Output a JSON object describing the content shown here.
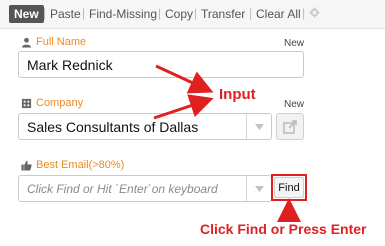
{
  "toolbar": {
    "new_label": "New",
    "paste_label": "Paste",
    "find_missing_label": "Find-Missing",
    "copy_label": "Copy",
    "transfer_label": "Transfer",
    "clear_all_label": "Clear All",
    "separator": "|"
  },
  "fields": {
    "full_name": {
      "label": "Full Name",
      "new_tag": "New",
      "value": "Mark Rednick",
      "icon": "person-icon"
    },
    "company": {
      "label": "Company",
      "new_tag": "New",
      "value": "Sales Consultants of Dallas",
      "icon": "building-icon"
    },
    "best_email": {
      "label": "Best Email(>80%)",
      "placeholder": "Click Find or Hit `Enter`on keyboard",
      "icon": "thumbs-up-icon",
      "find_label": "Find"
    }
  },
  "annotations": {
    "input_callout": "Input",
    "find_callout": "Click Find or Press Enter"
  },
  "colors": {
    "accent_label": "#ee8a20",
    "annotation": "#e02020",
    "toolbar_bg": "#f6f6f6"
  }
}
